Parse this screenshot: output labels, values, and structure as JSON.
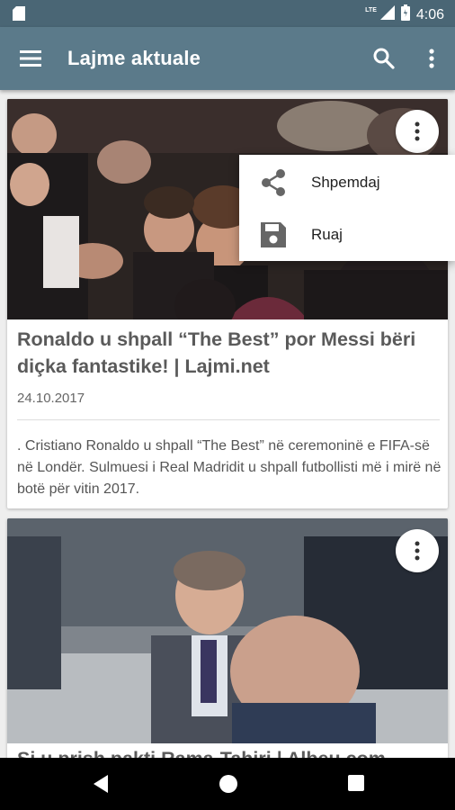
{
  "status_bar": {
    "time": "4:06",
    "network": "LTE",
    "icons": [
      "sd-card-icon",
      "signal-icon",
      "battery-icon"
    ]
  },
  "app_bar": {
    "title": "Lajme aktuale",
    "icons": [
      "menu-icon",
      "search-icon",
      "more-vert-icon"
    ]
  },
  "popup_menu": {
    "items": [
      {
        "label": "Shpemdaj",
        "icon": "share-icon"
      },
      {
        "label": "Ruaj",
        "icon": "save-icon"
      }
    ]
  },
  "articles": [
    {
      "headline": "Ronaldo u shpall “The Best” por Messi bëri diçka fantastike! | Lajmi.net",
      "date": "24.10.2017",
      "summary": ". Cristiano Ronaldo u shpall “The Best” në ceremoninë e FIFA-së në Londër. Sulmuesi i Real Madridit u shpall futbollisti më i mirë në botë për vitin 2017.",
      "image": "photo of football players at awards ceremony"
    },
    {
      "headline": "Si u prish pakti Rama-Tahiri | Albeu.com",
      "image": "photo of two politicians outdoors"
    }
  ],
  "nav_bar": {
    "icons": [
      "back-icon",
      "home-icon",
      "recents-icon"
    ]
  },
  "colors": {
    "status_bar": "#4a6675",
    "app_bar": "#5b7a8a",
    "background": "#eeeeee",
    "headline": "#5a5a5a"
  }
}
